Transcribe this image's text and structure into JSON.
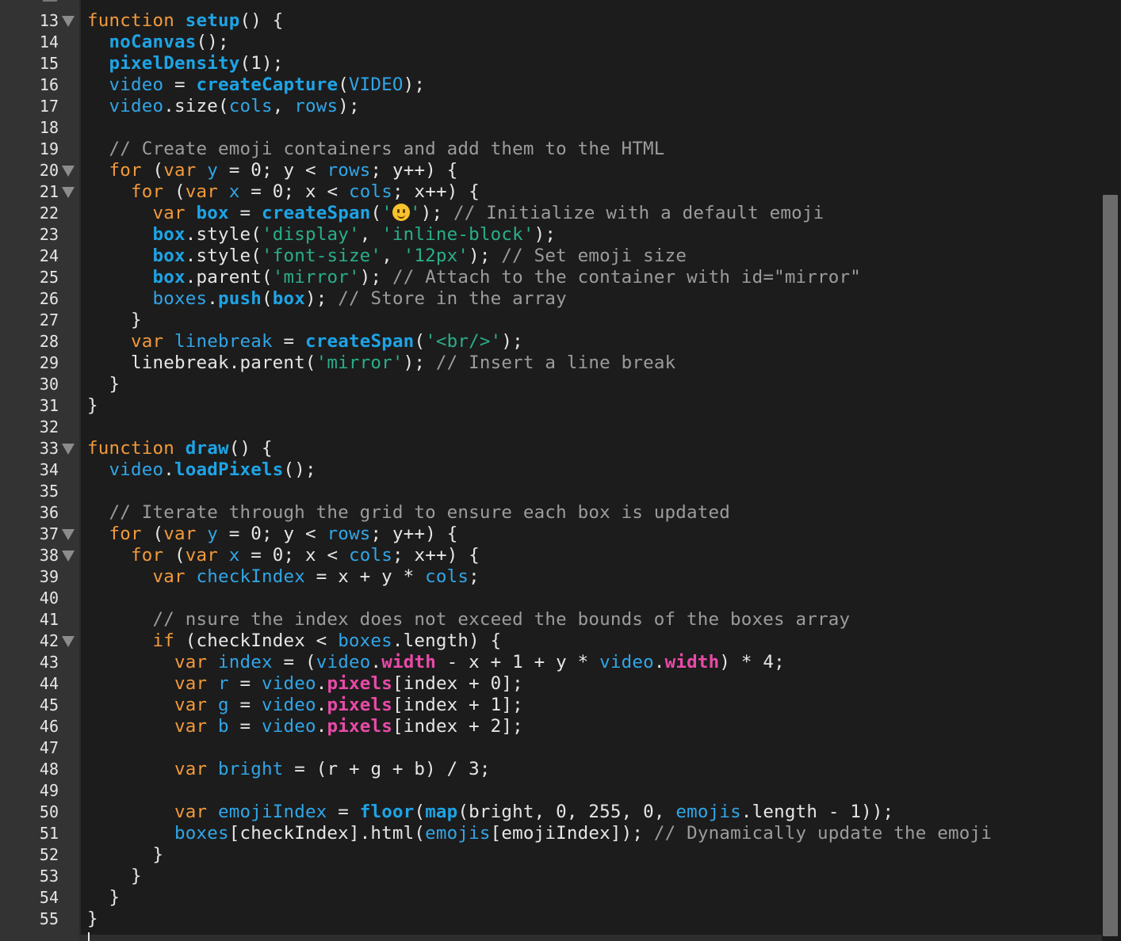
{
  "gutter": {
    "line_numbers": [
      "13",
      "14",
      "15",
      "16",
      "17",
      "18",
      "19",
      "20",
      "21",
      "22",
      "23",
      "24",
      "25",
      "26",
      "27",
      "28",
      "29",
      "30",
      "31",
      "32",
      "33",
      "34",
      "35",
      "36",
      "37",
      "38",
      "39",
      "40",
      "41",
      "42",
      "43",
      "44",
      "45",
      "46",
      "47",
      "48",
      "49",
      "50",
      "51",
      "52",
      "53",
      "54",
      "55"
    ],
    "fold_markers_at": [
      "13",
      "20",
      "21",
      "33",
      "37",
      "38",
      "42"
    ]
  },
  "code_lines": [
    [
      [
        "kw",
        "function "
      ],
      [
        "fn",
        "setup"
      ],
      [
        "pl",
        "() {"
      ]
    ],
    [
      [
        "pl",
        "  "
      ],
      [
        "fn",
        "noCanvas"
      ],
      [
        "pl",
        "();"
      ]
    ],
    [
      [
        "pl",
        "  "
      ],
      [
        "fn",
        "pixelDensity"
      ],
      [
        "pl",
        "(1);"
      ]
    ],
    [
      [
        "pl",
        "  "
      ],
      [
        "vr",
        "video"
      ],
      [
        "pl",
        " = "
      ],
      [
        "fn",
        "createCapture"
      ],
      [
        "pl",
        "("
      ],
      [
        "vr",
        "VIDEO"
      ],
      [
        "pl",
        ");"
      ]
    ],
    [
      [
        "pl",
        "  "
      ],
      [
        "vr",
        "video"
      ],
      [
        "pl",
        ".size("
      ],
      [
        "vr",
        "cols"
      ],
      [
        "pl",
        ", "
      ],
      [
        "vr",
        "rows"
      ],
      [
        "pl",
        ");"
      ]
    ],
    [],
    [
      [
        "pl",
        "  "
      ],
      [
        "cm",
        "// Create emoji containers and add them to the HTML"
      ]
    ],
    [
      [
        "pl",
        "  "
      ],
      [
        "kw",
        "for"
      ],
      [
        "pl",
        " ("
      ],
      [
        "kw",
        "var"
      ],
      [
        "pl",
        " "
      ],
      [
        "vr",
        "y"
      ],
      [
        "pl",
        " = 0; y < "
      ],
      [
        "vr",
        "rows"
      ],
      [
        "pl",
        "; y++) {"
      ]
    ],
    [
      [
        "pl",
        "    "
      ],
      [
        "kw",
        "for"
      ],
      [
        "pl",
        " ("
      ],
      [
        "kw",
        "var"
      ],
      [
        "pl",
        " "
      ],
      [
        "vr",
        "x"
      ],
      [
        "pl",
        " = 0; x < "
      ],
      [
        "vr",
        "cols"
      ],
      [
        "pl",
        "; x++) {"
      ]
    ],
    [
      [
        "pl",
        "      "
      ],
      [
        "kw",
        "var"
      ],
      [
        "pl",
        " "
      ],
      [
        "fn",
        "box"
      ],
      [
        "pl",
        " = "
      ],
      [
        "fn",
        "createSpan"
      ],
      [
        "pl",
        "("
      ],
      [
        "str",
        "'"
      ],
      [
        "emoji",
        "slightly-smiling-face"
      ],
      [
        "str",
        "'"
      ],
      [
        "pl",
        "); "
      ],
      [
        "cm",
        "// Initialize with a default emoji"
      ]
    ],
    [
      [
        "pl",
        "      "
      ],
      [
        "fn",
        "box"
      ],
      [
        "pl",
        ".style("
      ],
      [
        "str",
        "'display'"
      ],
      [
        "pl",
        ", "
      ],
      [
        "str",
        "'inline-block'"
      ],
      [
        "pl",
        ");"
      ]
    ],
    [
      [
        "pl",
        "      "
      ],
      [
        "fn",
        "box"
      ],
      [
        "pl",
        ".style("
      ],
      [
        "str",
        "'font-size'"
      ],
      [
        "pl",
        ", "
      ],
      [
        "str",
        "'12px'"
      ],
      [
        "pl",
        "); "
      ],
      [
        "cm",
        "// Set emoji size"
      ]
    ],
    [
      [
        "pl",
        "      "
      ],
      [
        "fn",
        "box"
      ],
      [
        "pl",
        ".parent("
      ],
      [
        "str",
        "'mirror'"
      ],
      [
        "pl",
        "); "
      ],
      [
        "cm",
        "// Attach to the container with id=\"mirror\""
      ]
    ],
    [
      [
        "pl",
        "      "
      ],
      [
        "vr",
        "boxes"
      ],
      [
        "pl",
        "."
      ],
      [
        "fn",
        "push"
      ],
      [
        "pl",
        "("
      ],
      [
        "fn",
        "box"
      ],
      [
        "pl",
        "); "
      ],
      [
        "cm",
        "// Store in the array"
      ]
    ],
    [
      [
        "pl",
        "    }"
      ]
    ],
    [
      [
        "pl",
        "    "
      ],
      [
        "kw",
        "var"
      ],
      [
        "pl",
        " "
      ],
      [
        "vr",
        "linebreak"
      ],
      [
        "pl",
        " = "
      ],
      [
        "fn",
        "createSpan"
      ],
      [
        "pl",
        "("
      ],
      [
        "str",
        "'<br/>'"
      ],
      [
        "pl",
        ");"
      ]
    ],
    [
      [
        "pl",
        "    linebreak.parent("
      ],
      [
        "str",
        "'mirror'"
      ],
      [
        "pl",
        "); "
      ],
      [
        "cm",
        "// Insert a line break"
      ]
    ],
    [
      [
        "pl",
        "  }"
      ]
    ],
    [
      [
        "pl",
        "}"
      ]
    ],
    [],
    [
      [
        "kw",
        "function "
      ],
      [
        "fn",
        "draw"
      ],
      [
        "pl",
        "() {"
      ]
    ],
    [
      [
        "pl",
        "  "
      ],
      [
        "vr",
        "video"
      ],
      [
        "pl",
        "."
      ],
      [
        "fn",
        "loadPixels"
      ],
      [
        "pl",
        "();"
      ]
    ],
    [],
    [
      [
        "pl",
        "  "
      ],
      [
        "cm",
        "// Iterate through the grid to ensure each box is updated"
      ]
    ],
    [
      [
        "pl",
        "  "
      ],
      [
        "kw",
        "for"
      ],
      [
        "pl",
        " ("
      ],
      [
        "kw",
        "var"
      ],
      [
        "pl",
        " "
      ],
      [
        "vr",
        "y"
      ],
      [
        "pl",
        " = 0; y < "
      ],
      [
        "vr",
        "rows"
      ],
      [
        "pl",
        "; y++) {"
      ]
    ],
    [
      [
        "pl",
        "    "
      ],
      [
        "kw",
        "for"
      ],
      [
        "pl",
        " ("
      ],
      [
        "kw",
        "var"
      ],
      [
        "pl",
        " "
      ],
      [
        "vr",
        "x"
      ],
      [
        "pl",
        " = 0; x < "
      ],
      [
        "vr",
        "cols"
      ],
      [
        "pl",
        "; x++) {"
      ]
    ],
    [
      [
        "pl",
        "      "
      ],
      [
        "kw",
        "var"
      ],
      [
        "pl",
        " "
      ],
      [
        "vr",
        "checkIndex"
      ],
      [
        "pl",
        " = x + y * "
      ],
      [
        "vr",
        "cols"
      ],
      [
        "pl",
        ";"
      ]
    ],
    [],
    [
      [
        "pl",
        "      "
      ],
      [
        "cm",
        "// nsure the index does not exceed the bounds of the boxes array"
      ]
    ],
    [
      [
        "pl",
        "      "
      ],
      [
        "kw",
        "if"
      ],
      [
        "pl",
        " (checkIndex < "
      ],
      [
        "vr",
        "boxes"
      ],
      [
        "pl",
        ".length) {"
      ]
    ],
    [
      [
        "pl",
        "        "
      ],
      [
        "kw",
        "var"
      ],
      [
        "pl",
        " "
      ],
      [
        "vr",
        "index"
      ],
      [
        "pl",
        " = ("
      ],
      [
        "vr",
        "video"
      ],
      [
        "pl",
        "."
      ],
      [
        "pk",
        "width"
      ],
      [
        "pl",
        " - x + 1 + y * "
      ],
      [
        "vr",
        "video"
      ],
      [
        "pl",
        "."
      ],
      [
        "pk",
        "width"
      ],
      [
        "pl",
        ") * 4;"
      ]
    ],
    [
      [
        "pl",
        "        "
      ],
      [
        "kw",
        "var"
      ],
      [
        "pl",
        " "
      ],
      [
        "vr",
        "r"
      ],
      [
        "pl",
        " = "
      ],
      [
        "vr",
        "video"
      ],
      [
        "pl",
        "."
      ],
      [
        "pk",
        "pixels"
      ],
      [
        "pl",
        "[index + 0];"
      ]
    ],
    [
      [
        "pl",
        "        "
      ],
      [
        "kw",
        "var"
      ],
      [
        "pl",
        " "
      ],
      [
        "vr",
        "g"
      ],
      [
        "pl",
        " = "
      ],
      [
        "vr",
        "video"
      ],
      [
        "pl",
        "."
      ],
      [
        "pk",
        "pixels"
      ],
      [
        "pl",
        "[index + 1];"
      ]
    ],
    [
      [
        "pl",
        "        "
      ],
      [
        "kw",
        "var"
      ],
      [
        "pl",
        " "
      ],
      [
        "vr",
        "b"
      ],
      [
        "pl",
        " = "
      ],
      [
        "vr",
        "video"
      ],
      [
        "pl",
        "."
      ],
      [
        "pk",
        "pixels"
      ],
      [
        "pl",
        "[index + 2];"
      ]
    ],
    [],
    [
      [
        "pl",
        "        "
      ],
      [
        "kw",
        "var"
      ],
      [
        "pl",
        " "
      ],
      [
        "vr",
        "bright"
      ],
      [
        "pl",
        " = (r + g + b) / 3;"
      ]
    ],
    [],
    [
      [
        "pl",
        "        "
      ],
      [
        "kw",
        "var"
      ],
      [
        "pl",
        " "
      ],
      [
        "vr",
        "emojiIndex"
      ],
      [
        "pl",
        " = "
      ],
      [
        "fn",
        "floor"
      ],
      [
        "pl",
        "("
      ],
      [
        "fn",
        "map"
      ],
      [
        "pl",
        "(bright, 0, 255, 0, "
      ],
      [
        "vr",
        "emojis"
      ],
      [
        "pl",
        ".length - 1));"
      ]
    ],
    [
      [
        "pl",
        "        "
      ],
      [
        "vr",
        "boxes"
      ],
      [
        "pl",
        "[checkIndex].html("
      ],
      [
        "vr",
        "emojis"
      ],
      [
        "pl",
        "[emojiIndex]); "
      ],
      [
        "cm",
        "// Dynamically update the emoji"
      ]
    ],
    [
      [
        "pl",
        "      }"
      ]
    ],
    [
      [
        "pl",
        "    }"
      ]
    ],
    [
      [
        "pl",
        "  }"
      ]
    ],
    [
      [
        "pl",
        "}"
      ]
    ]
  ],
  "colors": {
    "background": "#1c1c1c",
    "gutter": "#333333",
    "keyword": "#f29a3b",
    "function": "#1ea4e6",
    "variable": "#30a6e8",
    "string": "#29ae8a",
    "comment": "#9c9c9c",
    "property": "#e94aa8",
    "plain": "#e6e6e6"
  }
}
